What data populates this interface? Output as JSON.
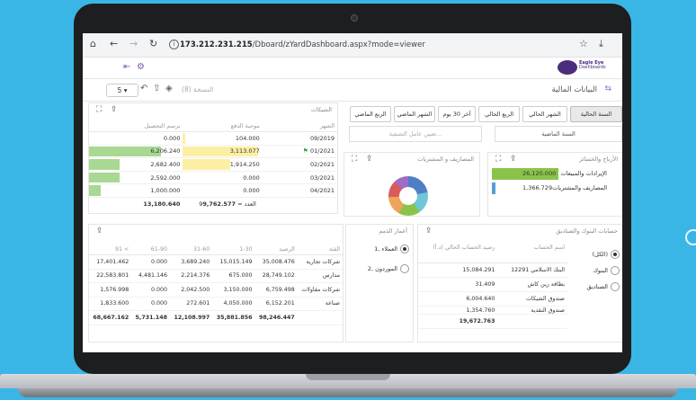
{
  "browser": {
    "url_host": "173.212.231.215",
    "url_path": "/Dboard/zYardDashboard.aspx?mode=viewer"
  },
  "header": {
    "logo_line1": "Eagle Eye",
    "logo_line2": "Dashboards"
  },
  "toolbar": {
    "title": "البيانات المالية",
    "version_label": "النسخة (8)",
    "page_size": "5"
  },
  "filters": {
    "buttons": [
      "السنة الحالية",
      "الشهر الحالي",
      "الربع الحالي",
      "آخر 30 يوم",
      "الشهر الماضي",
      "الربع الماضي"
    ],
    "previous_year": "السنة الماضية",
    "parameter_placeholder": "تعيين عامل التصفية..."
  },
  "checks": {
    "title": "الشيكات",
    "columns": [
      "الشهر",
      "موجبة الدفع",
      "برسم التحصيل"
    ],
    "rows": [
      {
        "month": "09/2019",
        "payable": "104.000",
        "collect": "0.000",
        "payable_fill": 0.03,
        "collect_fill": 0.0,
        "flag": false
      },
      {
        "month": "01/2021",
        "payable": "3,113.077",
        "collect": "6,206.240",
        "payable_fill": 1.0,
        "collect_fill": 1.0,
        "flag": true
      },
      {
        "month": "02/2021",
        "payable": "1,914.250",
        "collect": "2,682.400",
        "payable_fill": 0.62,
        "collect_fill": 0.43,
        "flag": false
      },
      {
        "month": "03/2021",
        "payable": "0.000",
        "collect": "2,592.000",
        "payable_fill": 0.0,
        "collect_fill": 0.42,
        "flag": false
      },
      {
        "month": "04/2021",
        "payable": "0.000",
        "collect": "1,000.000",
        "payable_fill": 0.0,
        "collect_fill": 0.16,
        "flag": false
      }
    ],
    "total_count_label": "العدد = 9",
    "total_payable": "9,762.577",
    "total_collect": "13,180.640"
  },
  "profit": {
    "title": "الأرباح والخسائر",
    "rows": [
      {
        "label": "الإيرادات والمبيعات",
        "value": "26,120.000",
        "color": "#8bc34a",
        "fill": 1.0
      },
      {
        "label": "المصاريف والمشتريات",
        "value": "1,366.729",
        "color": "#5b9bd5",
        "fill": 0.05
      }
    ]
  },
  "expenses": {
    "title": "المصاريف و المشتريات",
    "slices": [
      {
        "share": 0.22,
        "color": "#4e7fc6"
      },
      {
        "share": 0.18,
        "color": "#6fc6d8"
      },
      {
        "share": 0.18,
        "color": "#8bc34a"
      },
      {
        "share": 0.16,
        "color": "#f0a35a"
      },
      {
        "share": 0.14,
        "color": "#d85c5c"
      },
      {
        "share": 0.12,
        "color": "#a06bc4"
      }
    ]
  },
  "customers": {
    "title": "أعمار الذمم",
    "options": [
      {
        "label": "1, العملاء",
        "selected": true
      },
      {
        "label": "2, الموردون",
        "selected": false
      }
    ]
  },
  "aging": {
    "columns": [
      "الفئة",
      "الرصيد",
      "1-30",
      "31-60",
      "61-90",
      "91 <"
    ],
    "rows": [
      [
        "شركات تجارية",
        "35,008.476",
        "15,015.149",
        "3,689.240",
        "0.000",
        "17,401.462"
      ],
      [
        "مدارس",
        "28,749.102",
        "675.000",
        "2,214.376",
        "4,481.146",
        "22,583.801"
      ],
      [
        "شركات مقاولات",
        "6,759.498",
        "3,150.000",
        "2,042.500",
        "0.000",
        "1,576.998"
      ],
      [
        "صناعة",
        "6,152.201",
        "4,050.000",
        "272.601",
        "0.000",
        "1,833.600"
      ]
    ],
    "total": [
      "",
      "98,246.447",
      "35,881.856",
      "12,108.997",
      "5,731.148",
      "68,667.162"
    ]
  },
  "banks": {
    "title": "حسابات البنوك والصناديق",
    "options": [
      {
        "label": "(الكل)",
        "selected": true
      },
      {
        "label": "البنوك",
        "selected": false
      },
      {
        "label": "الصناديق",
        "selected": false
      }
    ],
    "columns": [
      "اسم الحساب",
      "رصيد الحساب الحالي (د.أ)"
    ],
    "rows": [
      [
        "البنك الاسلامي 12291",
        "15,084.291"
      ],
      [
        "بطاقة زين كاش",
        "31.409"
      ],
      [
        "صندوق الشيكات",
        "6,004.640"
      ],
      [
        "صندوق النقدية",
        "1,354.760"
      ]
    ],
    "total": "19,672.763"
  }
}
